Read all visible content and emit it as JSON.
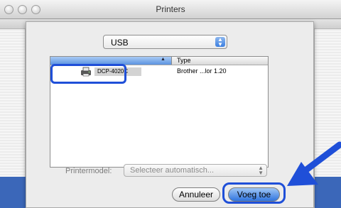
{
  "window": {
    "title": "Printers"
  },
  "connection_popup": {
    "value": "USB"
  },
  "printer_list": {
    "columns": {
      "type": "Type"
    },
    "rows": [
      {
        "name": "DCP-4020C",
        "type": "Brother ...lor 1.20"
      }
    ]
  },
  "model": {
    "label": "Printermodel:",
    "value": "Selecteer automatisch..."
  },
  "buttons": {
    "cancel": "Annuleer",
    "add": "Voeg toe"
  },
  "colors": {
    "highlight": "#1f4fd8",
    "pointer": "#1f4fd8",
    "aqua_blue": "#3b7fe0"
  }
}
